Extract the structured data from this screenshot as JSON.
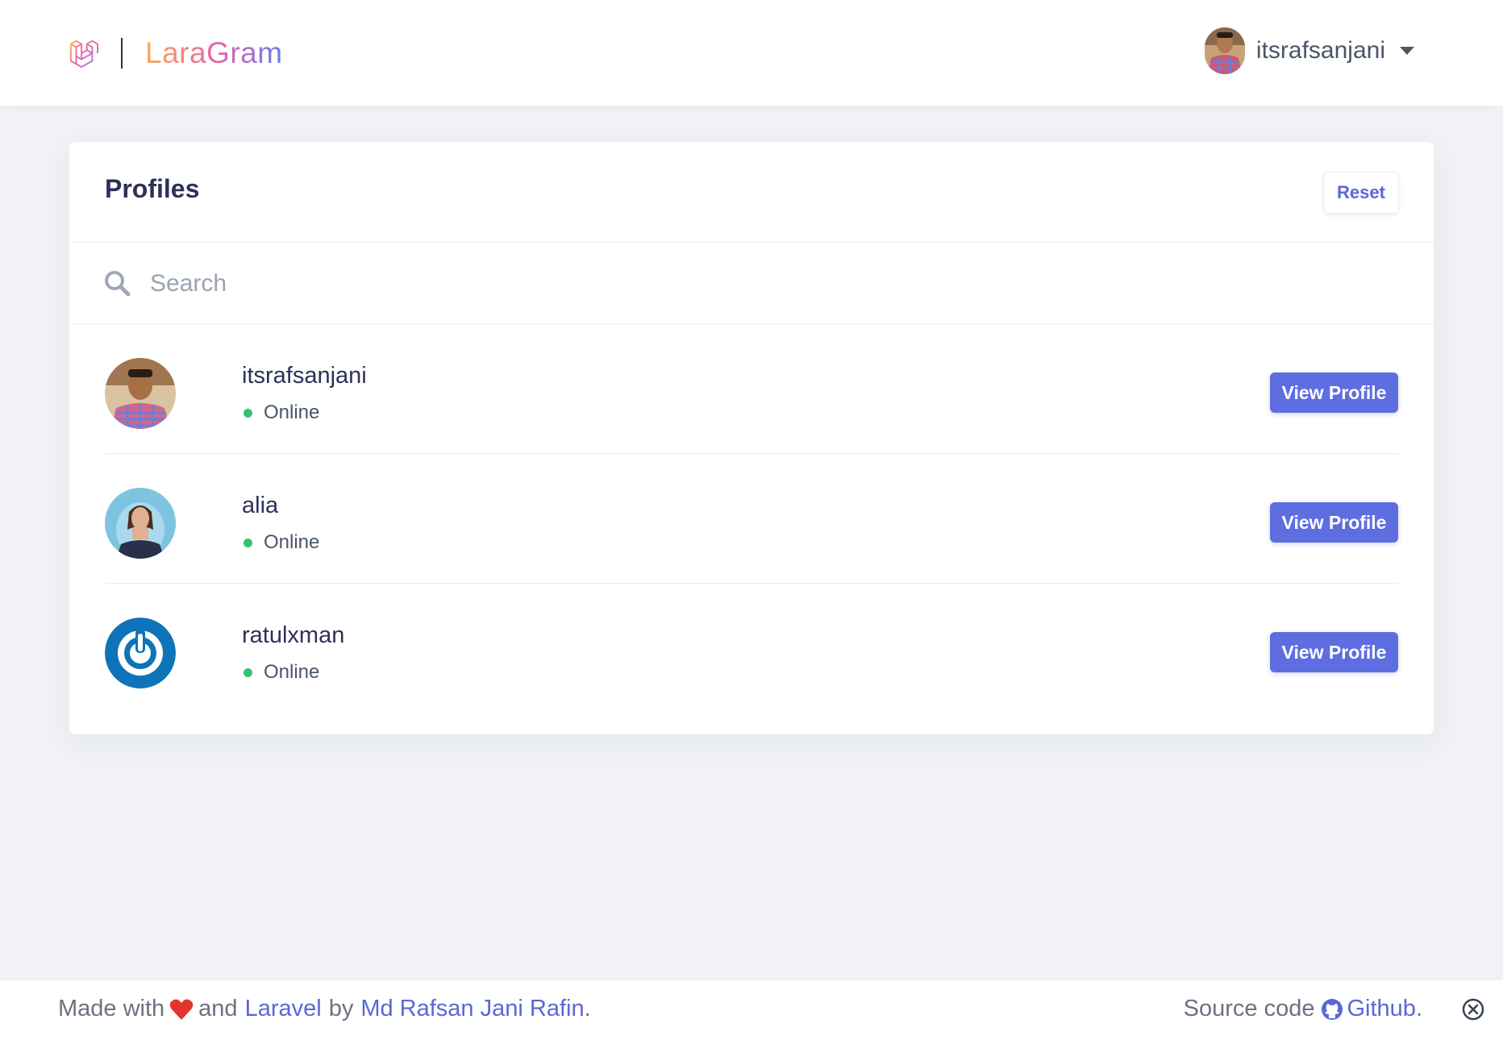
{
  "header": {
    "brand": "LaraGram",
    "user_name": "itsrafsanjani"
  },
  "card": {
    "title": "Profiles",
    "reset_label": "Reset",
    "search_placeholder": "Search"
  },
  "profiles": [
    {
      "username": "itsrafsanjani",
      "status": "Online",
      "button": "View Profile"
    },
    {
      "username": "alia",
      "status": "Online",
      "button": "View Profile"
    },
    {
      "username": "ratulxman",
      "status": "Online",
      "button": "View Profile"
    }
  ],
  "footer": {
    "made_with": "Made with",
    "and": "and",
    "laravel": "Laravel",
    "by": "by",
    "author": "Md Rafsan Jani Rafin",
    "period": ".",
    "source_code": "Source code",
    "github": "Github",
    "period2": "."
  },
  "colors": {
    "accent": "#5e6ee0",
    "online": "#38c172",
    "heart": "#e3342f",
    "background": "#f0f2f5"
  },
  "icons": [
    "laravel-logo-icon",
    "caret-down-icon",
    "search-icon",
    "heart-icon",
    "github-icon",
    "close-circle-icon"
  ]
}
